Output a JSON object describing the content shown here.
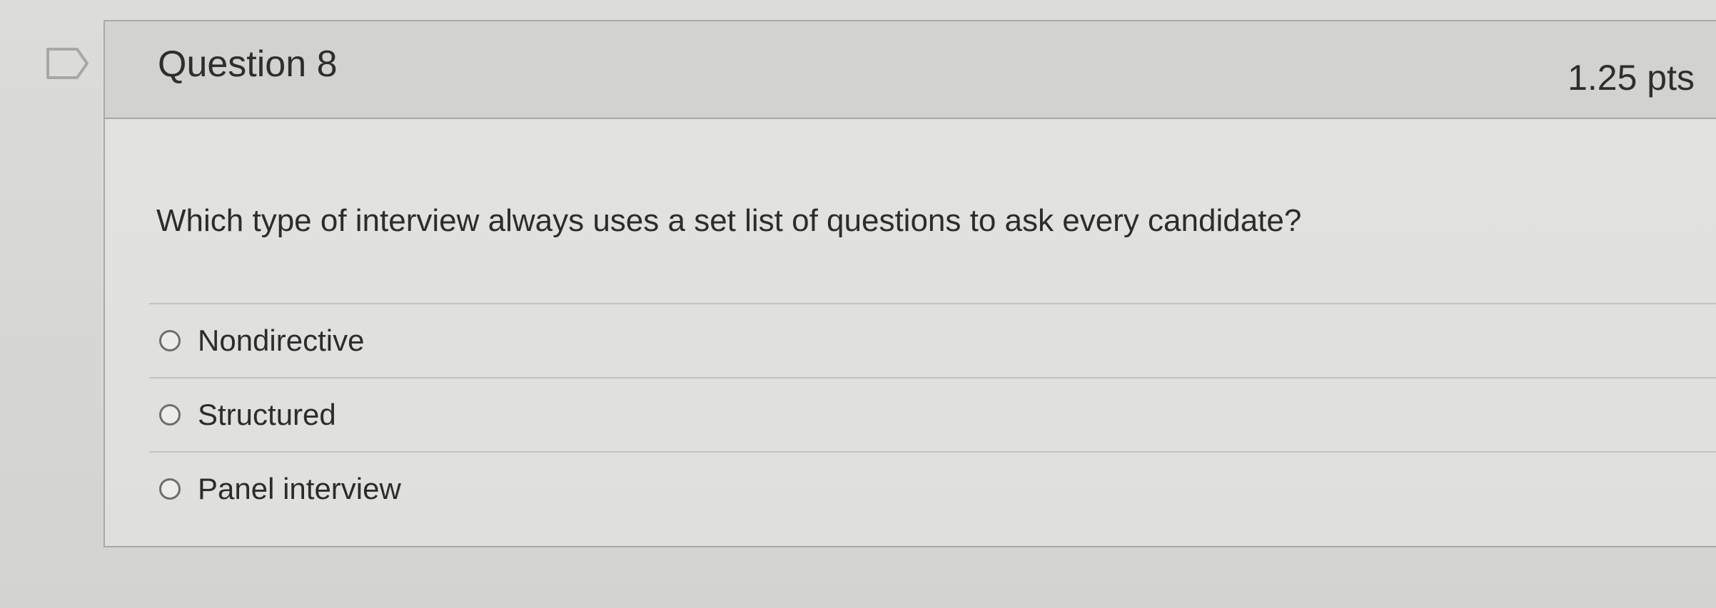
{
  "question": {
    "title": "Question 8",
    "points": "1.25 pts",
    "text": "Which type of interview always uses a set list of questions to ask every candidate?",
    "flag_icon": "flag-outline-icon",
    "answers": [
      {
        "label": "Nondirective",
        "selected": false
      },
      {
        "label": "Structured",
        "selected": false
      },
      {
        "label": "Panel interview",
        "selected": false
      }
    ]
  },
  "colors": {
    "background": "#d9d9d7",
    "header": "#d2d2d0",
    "body": "#e2e2e0",
    "border": "#a9a9a7",
    "text": "#2e2e2e"
  }
}
